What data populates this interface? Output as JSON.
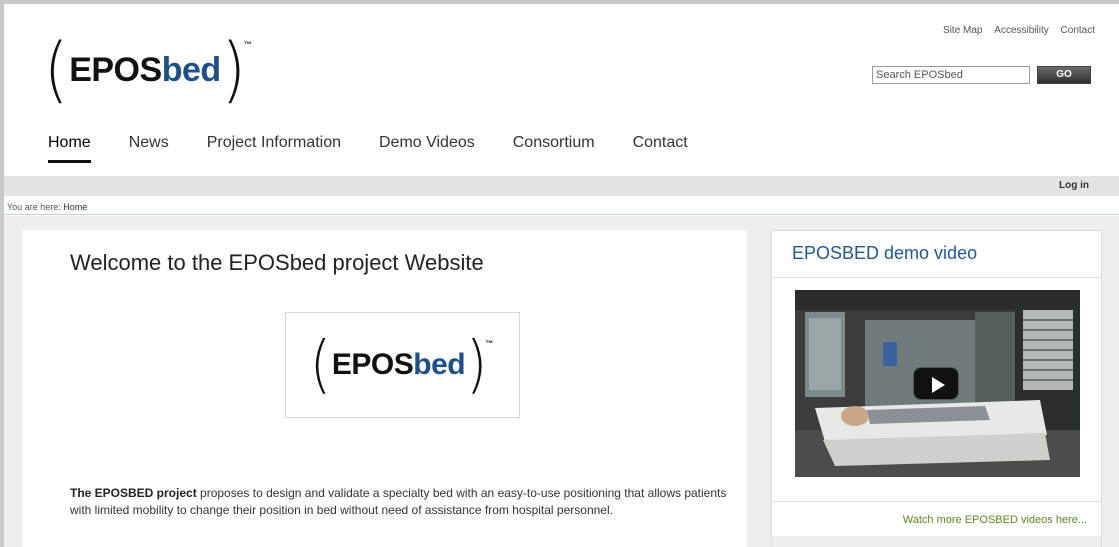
{
  "header": {
    "logo": {
      "main": "EPOS",
      "accent": "bed",
      "tm": "™"
    },
    "util_links": [
      "Site Map",
      "Accessibility",
      "Contact"
    ],
    "search": {
      "placeholder": "Search EPOSbed",
      "button": "GO"
    },
    "nav": [
      {
        "label": "Home",
        "active": true
      },
      {
        "label": "News"
      },
      {
        "label": "Project Information"
      },
      {
        "label": "Demo Videos"
      },
      {
        "label": "Consortium"
      },
      {
        "label": "Contact"
      }
    ],
    "login": "Log in"
  },
  "breadcrumb": {
    "prefix": "You are here: ",
    "current": "Home"
  },
  "main": {
    "title": "Welcome to the EPOSbed project Website",
    "intro_bold": "The EPOSBED project",
    "intro_rest": " proposes to design and validate a specialty bed with an easy-to-use positioning that allows patients with limited mobility to change their position in bed without need of assistance from hospital personnel."
  },
  "sidebar": {
    "title": "EPOSBED demo video",
    "more_link": "Watch more EPOSBED videos here..."
  },
  "colors": {
    "accent_blue": "#1d4f8a",
    "link_green": "#5a8a1a",
    "title_blue": "#1d5a96"
  }
}
